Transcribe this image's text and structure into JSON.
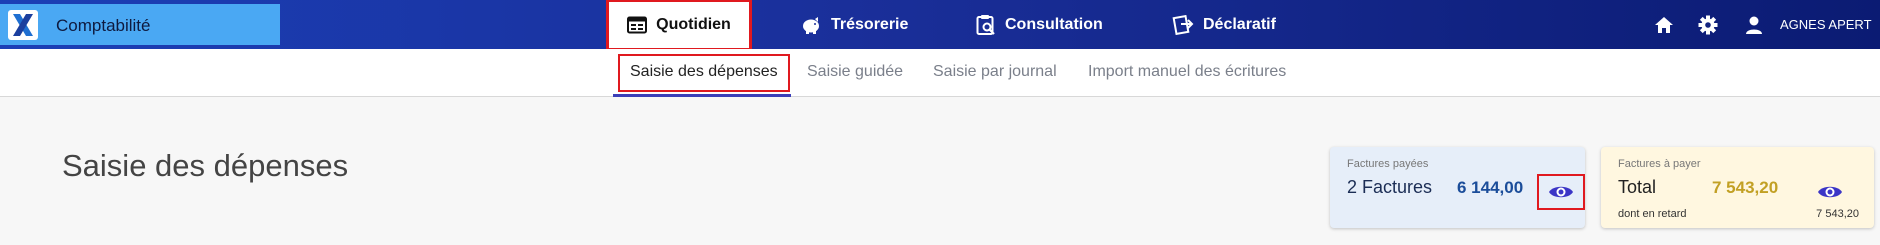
{
  "app": {
    "title": "Comptabilité"
  },
  "nav": {
    "quotidien": "Quotidien",
    "tresorerie": "Trésorerie",
    "consultation": "Consultation",
    "declaratif": "Déclaratif"
  },
  "user": {
    "name": "AGNES APERT"
  },
  "subnav": {
    "saisie_depenses": "Saisie des dépenses",
    "saisie_guidee": "Saisie guidée",
    "saisie_journal": "Saisie par journal",
    "import_manuel": "Import manuel des écritures"
  },
  "page": {
    "title": "Saisie des dépenses"
  },
  "cards": {
    "paid": {
      "label": "Factures payées",
      "count": "2 Factures",
      "amount": "6 144,00"
    },
    "due": {
      "label": "Factures à payer",
      "total_label": "Total",
      "amount": "7 543,20",
      "late_label": "dont en retard",
      "late_amount": "7 543,20"
    }
  },
  "icons": {
    "logo": "x-logo-icon",
    "quotidien": "calendar-icon",
    "tresorerie": "piggy-bank-icon",
    "consultation": "clipboard-search-icon",
    "declaratif": "document-send-icon",
    "home": "home-icon",
    "settings": "gear-icon",
    "user": "user-icon",
    "view": "eye-icon"
  },
  "colors": {
    "header_start": "#1b3fb6",
    "header_end": "#0b1b73",
    "brand_bg": "#4aa8f3",
    "highlight": "#e0191f",
    "tab_underline": "#3c3fb8",
    "paid_amount": "#1b4d9a",
    "due_amount": "#c2a024",
    "eye": "#3b35c6"
  }
}
